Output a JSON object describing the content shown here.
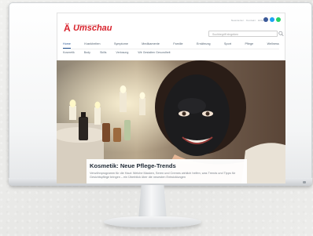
{
  "site": {
    "logo": "Umschau",
    "logo_tagline": "Apotheken Umschau",
    "search_placeholder": "Suchbegriff eingeben",
    "top_links": "Newsletter · Kontakt · Hilfe",
    "social": [
      {
        "name": "facebook",
        "color": "#3b5998"
      },
      {
        "name": "twitter",
        "color": "#1da1f2"
      },
      {
        "name": "whatsapp",
        "color": "#25d366"
      }
    ]
  },
  "nav_primary": [
    "Home",
    "Krankheiten",
    "Symptome",
    "Medikamente",
    "Familie",
    "Ernährung",
    "Sport",
    "Pflege",
    "Wellness"
  ],
  "nav_secondary": [
    "Kosmetik",
    "Body",
    "Skills",
    "Verlosung",
    "Wir Gestalten Gesundheit"
  ],
  "article": {
    "title": "Kosmetik: Neue Pflege-Trends",
    "teaser_line1": "Verwöhnprogramm für die Haut: Welche Masken, Seren und Cremes wirklich helfen, was Trends und Tipps für",
    "teaser_line2": "Gesichtspflege bringen – ein Überblick über die neuesten Entwicklungen"
  },
  "colors": {
    "brand_red": "#d9232d",
    "nav_active": "#1e4f8f"
  }
}
